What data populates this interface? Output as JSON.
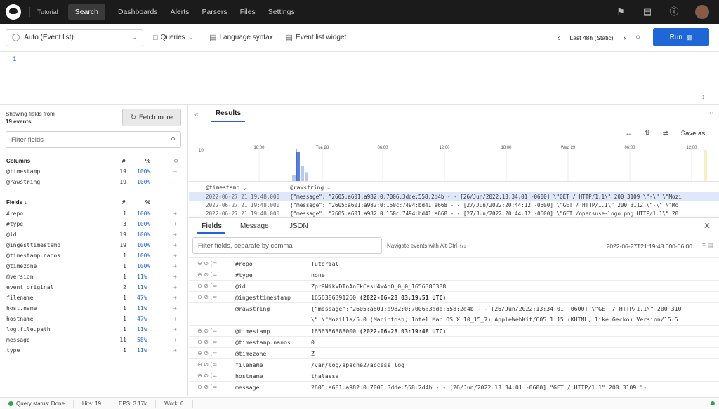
{
  "nav": {
    "repo": "Tutorial",
    "items": [
      "Search",
      "Dashboards",
      "Alerts",
      "Parsers",
      "Files",
      "Settings"
    ],
    "active": "Search"
  },
  "toolbar": {
    "mode": "Auto (Event list)",
    "queries": "Queries",
    "language_syntax": "Language syntax",
    "event_list_widget": "Event list widget",
    "time_range": "Last 48h (Static)",
    "run": "Run"
  },
  "editor": {
    "line": "1"
  },
  "left": {
    "showing_line1": "Showing fields from",
    "showing_line2": "19 events",
    "fetch_more": "Fetch more",
    "filter_placeholder": "Filter fields",
    "columns_header": "Columns",
    "fields_header": "Fields ↓",
    "hash": "#",
    "pct": "%",
    "columns": [
      {
        "name": "@timestamp",
        "count": "19",
        "pct": "100%"
      },
      {
        "name": "@rawstring",
        "count": "19",
        "pct": "100%"
      }
    ],
    "fields": [
      {
        "name": "#repo",
        "count": "1",
        "pct": "100%"
      },
      {
        "name": "#type",
        "count": "3",
        "pct": "100%"
      },
      {
        "name": "@id",
        "count": "19",
        "pct": "100%"
      },
      {
        "name": "@ingesttimestamp",
        "count": "19",
        "pct": "100%"
      },
      {
        "name": "@timestamp.nanos",
        "count": "1",
        "pct": "100%"
      },
      {
        "name": "@timezone",
        "count": "1",
        "pct": "100%"
      },
      {
        "name": "@version",
        "count": "1",
        "pct": "11%"
      },
      {
        "name": "event.original",
        "count": "2",
        "pct": "11%"
      },
      {
        "name": "filename",
        "count": "1",
        "pct": "47%"
      },
      {
        "name": "host.name",
        "count": "1",
        "pct": "11%"
      },
      {
        "name": "hostname",
        "count": "1",
        "pct": "47%"
      },
      {
        "name": "log.file.path",
        "count": "1",
        "pct": "11%"
      },
      {
        "name": "message",
        "count": "11",
        "pct": "58%"
      },
      {
        "name": "type",
        "count": "1",
        "pct": "11%"
      }
    ]
  },
  "results": {
    "tab": "Results",
    "save_as": "Save as...",
    "histogram_ticks": [
      "18:00",
      "Tue 28",
      "06:00",
      "12:00",
      "18:00",
      "Wed 29",
      "06:00",
      "12:00"
    ],
    "histogram_ymax": "10",
    "histogram_bars": [
      2,
      10,
      5,
      3
    ],
    "col_timestamp": "@timestamp",
    "col_rawstring": "@rawstring",
    "events": [
      {
        "ts": "2022-06-27 21:19:48.000",
        "msg": "{\"message\": \"2605:a601:a982:0:7006:3dde:558:2d4b - - [26/Jun/2022:13:34:01 -0600] \\\"GET / HTTP/1.1\\\" 200 3109 \\\"-\\\" \\\"Mozi"
      },
      {
        "ts": "2022-06-27 21:19:48.000",
        "msg": "{\"message\": \"2605:a601:a982:0:150c:7494:bd41:a668 - - [27/Jun/2022:20:44:12 -0600] \\\"GET / HTTP/1.1\\\" 200 3112 \\\"-\\\" \\\"Mo"
      },
      {
        "ts": "2022-06-27 21:19:48.000",
        "msg": "{\"message\": \"2605:a601:a982:0:150c:7494:bd41:a668 - - [27/Jun/2022:20:44:12 -0600] \\\"GET /opensuse-logo.png HTTP/1.1\\\" 20"
      }
    ]
  },
  "detail": {
    "tabs": [
      "Fields",
      "Message",
      "JSON"
    ],
    "filter_placeholder": "Filter fields, separate by comma",
    "hint": "Navigate events with Alt-Ctrl-↑/↓",
    "time": "2022-06-27T21:19:48.000-06:00",
    "rows": [
      {
        "key": "#repo",
        "val": "Tutorial",
        "extra": ""
      },
      {
        "key": "#type",
        "val": "none",
        "extra": ""
      },
      {
        "key": "@id",
        "val": "ZprRNikVDTnAnFkCasU4wAdO_0_0_1656386388",
        "extra": ""
      },
      {
        "key": "@ingesttimestamp",
        "val": "1656386391260",
        "extra": "(2022-06-28 03:19:51 UTC)"
      },
      {
        "key": "@rawstring",
        "val": "{\"message\":\"2605:a601:a982:0:7006:3dde:558:2d4b - - [26/Jun/2022:13:34:01 -0600] \\\"GET / HTTP/1.1\\\" 200 310",
        "val2": "\\\" \\\"Mozilla/5.0 (Macintosh; Intel Mac OS X 10_15_7) AppleWebKit/605.1.15 (KHTML, like Gecko) Version/15.5",
        "extra": ""
      },
      {
        "key": "@timestamp",
        "val": "1656386388000",
        "extra": "(2022-06-28 03:19:48 UTC)"
      },
      {
        "key": "@timestamp.nanos",
        "val": "0",
        "extra": ""
      },
      {
        "key": "@timezone",
        "val": "Z",
        "extra": ""
      },
      {
        "key": "filename",
        "val": "/var/log/apache2/access_log",
        "extra": ""
      },
      {
        "key": "hostname",
        "val": "thalassa",
        "extra": ""
      },
      {
        "key": "message",
        "val": "2605:a601:a982:0:7006:3dde:558:2d4b - - [26/Jun/2022:13:34:01 -0600] \"GET / HTTP/1.1\" 200 3109 \"-",
        "extra": ""
      }
    ]
  },
  "status": {
    "query_status": "Query status: Done",
    "hits": "Hits: 19",
    "eps": "EPS: 3.17k",
    "work": "Work: 0"
  },
  "colors": {
    "accent": "#1f66d6",
    "topbar": "#1b1b1b",
    "status_ok": "#2ea44f"
  }
}
